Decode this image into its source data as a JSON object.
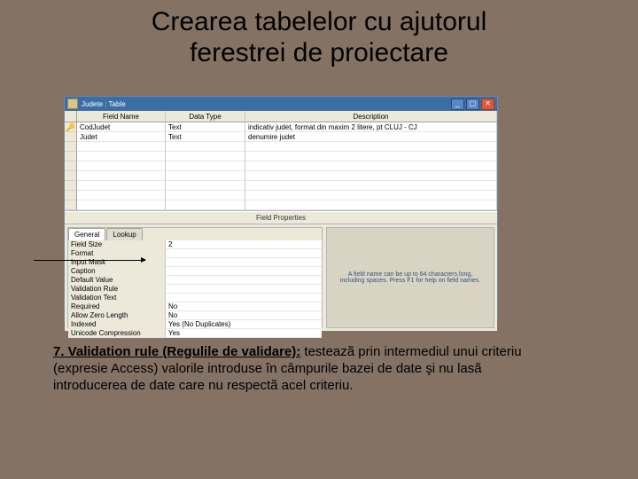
{
  "title": {
    "line1": "Crearea tabelelor cu ajutorul",
    "line2": "ferestrei de proiectare"
  },
  "window": {
    "title": "Judete : Table",
    "headers": {
      "field": "Field Name",
      "type": "Data Type",
      "desc": "Description"
    },
    "rows": [
      {
        "sel": "🔑",
        "name": "CodJudet",
        "type": "Text",
        "desc": "indicativ judet, format din maxim 2 litere, pt CLUJ - CJ"
      },
      {
        "sel": "",
        "name": "Judet",
        "type": "Text",
        "desc": "denumire judet"
      },
      {
        "sel": "",
        "name": "",
        "type": "",
        "desc": ""
      },
      {
        "sel": "",
        "name": "",
        "type": "",
        "desc": ""
      },
      {
        "sel": "",
        "name": "",
        "type": "",
        "desc": ""
      },
      {
        "sel": "",
        "name": "",
        "type": "",
        "desc": ""
      },
      {
        "sel": "",
        "name": "",
        "type": "",
        "desc": ""
      },
      {
        "sel": "",
        "name": "",
        "type": "",
        "desc": ""
      },
      {
        "sel": "",
        "name": "",
        "type": "",
        "desc": ""
      }
    ],
    "props_header": "Field Properties",
    "tabs": {
      "general": "General",
      "lookup": "Lookup"
    },
    "properties": [
      {
        "label": "Field Size",
        "value": "2"
      },
      {
        "label": "Format",
        "value": ""
      },
      {
        "label": "Input Mask",
        "value": ""
      },
      {
        "label": "Caption",
        "value": ""
      },
      {
        "label": "Default Value",
        "value": ""
      },
      {
        "label": "Validation Rule",
        "value": ""
      },
      {
        "label": "Validation Text",
        "value": ""
      },
      {
        "label": "Required",
        "value": "No"
      },
      {
        "label": "Allow Zero Length",
        "value": "No"
      },
      {
        "label": "Indexed",
        "value": "Yes (No Duplicates)"
      },
      {
        "label": "Unicode Compression",
        "value": "Yes"
      }
    ],
    "hint": "A field name can be up to 64 characters long, including spaces. Press F1 for help on field names."
  },
  "caption": {
    "lead": "7. Validation rule (Regulile de validare):",
    "body": " testeazã prin intermediul unui criteriu (expresie Access) valorile introduse în câmpurile bazei de date şi nu lasã introducerea de date care nu respectã acel criteriu."
  }
}
